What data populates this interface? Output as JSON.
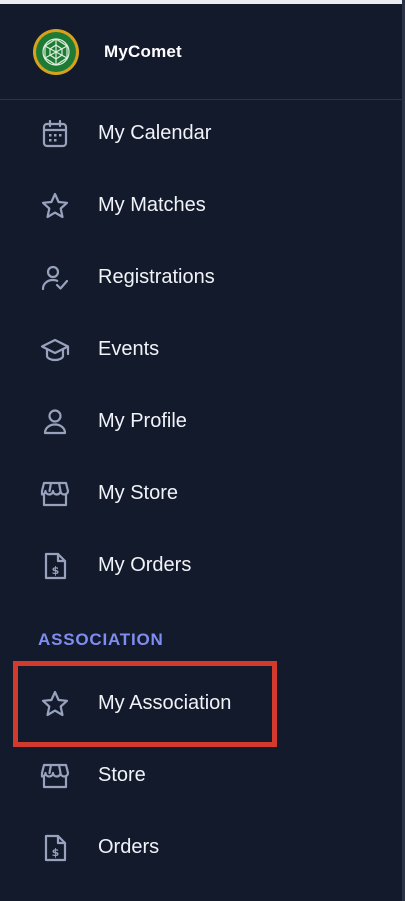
{
  "brand": {
    "name": "MyComet",
    "logo_icon": "globe-network-logo"
  },
  "nav": {
    "items": [
      {
        "label": "My Calendar",
        "icon": "calendar-icon"
      },
      {
        "label": "My Matches",
        "icon": "star-icon"
      },
      {
        "label": "Registrations",
        "icon": "user-check-icon"
      },
      {
        "label": "Events",
        "icon": "graduation-cap-icon"
      },
      {
        "label": "My Profile",
        "icon": "user-icon"
      },
      {
        "label": "My Store",
        "icon": "store-icon"
      },
      {
        "label": "My Orders",
        "icon": "invoice-icon"
      }
    ]
  },
  "association": {
    "section_title": "ASSOCIATION",
    "items": [
      {
        "label": "My Association",
        "icon": "star-icon"
      },
      {
        "label": "Store",
        "icon": "store-icon"
      },
      {
        "label": "Orders",
        "icon": "invoice-icon"
      }
    ]
  },
  "colors": {
    "background": "#131a2c",
    "section_accent": "#7f8df0",
    "icon": "#98a2bd",
    "highlight_border": "#d23a2e",
    "logo_green": "#1f7a36",
    "logo_ring": "#d6a21e"
  }
}
